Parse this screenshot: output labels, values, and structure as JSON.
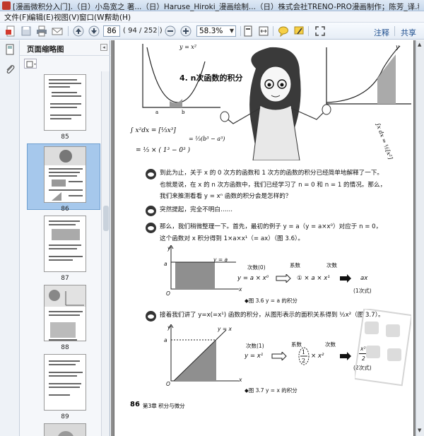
{
  "window": {
    "title": "[漫画微积分入门].（日）小岛宽之 著...（日）Haruse_Hiroki_漫画绘制...（日）株式会社TRENO-PRO漫画制作；陈芳_译.科学出版社..."
  },
  "menu": {
    "items": [
      "文件(F)",
      "编辑(E)",
      "视图(V)",
      "窗口(W)",
      "帮助(H)"
    ]
  },
  "toolbar": {
    "page_value": "86",
    "page_count": "( 94 / 252 )",
    "zoom_value": "58.3%",
    "annotate_label": "注释",
    "share_label": "共享"
  },
  "sidebar": {
    "panel_title": "页面缩略图",
    "thumbnails": [
      {
        "label": "85"
      },
      {
        "label": "86"
      },
      {
        "label": "87"
      },
      {
        "label": "88"
      },
      {
        "label": "89"
      }
    ]
  },
  "document": {
    "chapter_title": "4. n次函数的积分",
    "paragraphs": [
      "到此为止，关于 x 的 0 次方的函数和 1 次方的函数的积分已经简单地解释了一下。",
      "也就是说，在 x 的 n 次方函数中，我们已经学习了 n = 0 和 n = 1 的情况。那么，",
      "我们来推测看看 y = xⁿ 函数的积分会是怎样的？",
      "突然提起，完全不明白……",
      "那么，我们稍微整理一下。首先，最初的例子 y = a（y = a×x⁰）对应于 n = 0，",
      "这个函数对 x 积分得到 1×a×x¹（= ax）（图 3.6）。",
      "接着我们讲了 y=x(=x¹) 函数的积分，从图形表示的面积关系得到 ½x²（图 3.7）。"
    ],
    "figure1": {
      "caption": "◆图 3.6  y = a 的积分",
      "axis_y": "y",
      "axis_x": "x",
      "origin": "O",
      "line_label": "y = a",
      "a_label": "a",
      "degree_label": "次数(0)",
      "coef_label": "系数",
      "degree_label2": "次数",
      "formula1": "y = a × x⁰",
      "formula2": "① × a × x¹",
      "result": "ax",
      "result_note": "(1次式)"
    },
    "figure2": {
      "caption": "◆图 3.7  y = x 的积分",
      "axis_y": "y",
      "axis_x": "x",
      "origin": "O",
      "line_label": "y = x",
      "a_label": "a",
      "degree_label": "次数(1)",
      "coef_label": "系数",
      "degree_label2": "次数",
      "formula1": "y = x¹",
      "formula2": "× x²",
      "result_num": "x²",
      "result_den": "2",
      "result_note": "(2次式)"
    },
    "footer_page": "86",
    "footer_text": "第3章  积分与微分"
  }
}
